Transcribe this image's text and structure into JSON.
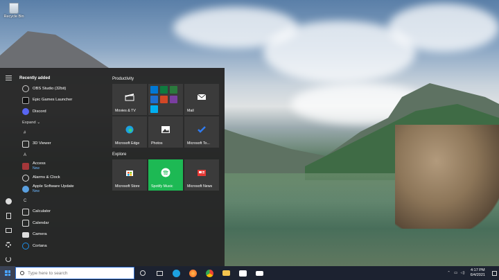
{
  "desktop": {
    "recycle_bin_label": "Recycle Bin"
  },
  "start_menu": {
    "recently_added_header": "Recently added",
    "recent_apps": [
      {
        "name": "OBS Studio (32bit)",
        "color": "#2b2b2b"
      },
      {
        "name": "Epic Games Launcher",
        "color": "#111111"
      },
      {
        "name": "Discord",
        "color": "#5865f2"
      }
    ],
    "expand_label": "Expand ⌄",
    "sections": {
      "hash": "#",
      "a": "A",
      "c": "C"
    },
    "hash_apps": [
      {
        "name": "3D Viewer",
        "color": "#4a90d9"
      }
    ],
    "a_apps": [
      {
        "name": "Access",
        "badge": "New",
        "color": "#a4373a"
      },
      {
        "name": "Alarms & Clock",
        "badge": "",
        "color": "#0078d4"
      },
      {
        "name": "Apple Software Update",
        "badge": "New",
        "color": "#5aa0e0"
      }
    ],
    "c_apps": [
      {
        "name": "Calculator",
        "color": "#505050"
      },
      {
        "name": "Calendar",
        "color": "#0063b1"
      },
      {
        "name": "Camera",
        "color": "#505050"
      },
      {
        "name": "Cortana",
        "color": "#1e8fe8"
      }
    ],
    "productivity_header": "Productivity",
    "explore_header": "Explore",
    "productivity_tiles": [
      {
        "label": "Movies & TV",
        "icon": "clapper-icon"
      },
      {
        "label": "",
        "icon": "office-apps-icon"
      },
      {
        "label": "Mail",
        "icon": "mail-icon"
      },
      {
        "label": "Microsoft Edge",
        "icon": "edge-icon"
      },
      {
        "label": "Photos",
        "icon": "photos-icon"
      },
      {
        "label": "Microsoft To...",
        "icon": "todo-icon"
      }
    ],
    "explore_tiles": [
      {
        "label": "Microsoft Store",
        "icon": "store-icon"
      },
      {
        "label": "Spotify Music",
        "icon": "spotify-icon"
      },
      {
        "label": "Microsoft News",
        "icon": "news-icon"
      }
    ]
  },
  "taskbar": {
    "search_placeholder": "Type here to search",
    "time": "4:17 PM",
    "date": "6/4/2021"
  },
  "colors": {
    "accent": "#0078d4",
    "spotify": "#1db954",
    "taskbar": "#1c2230"
  }
}
